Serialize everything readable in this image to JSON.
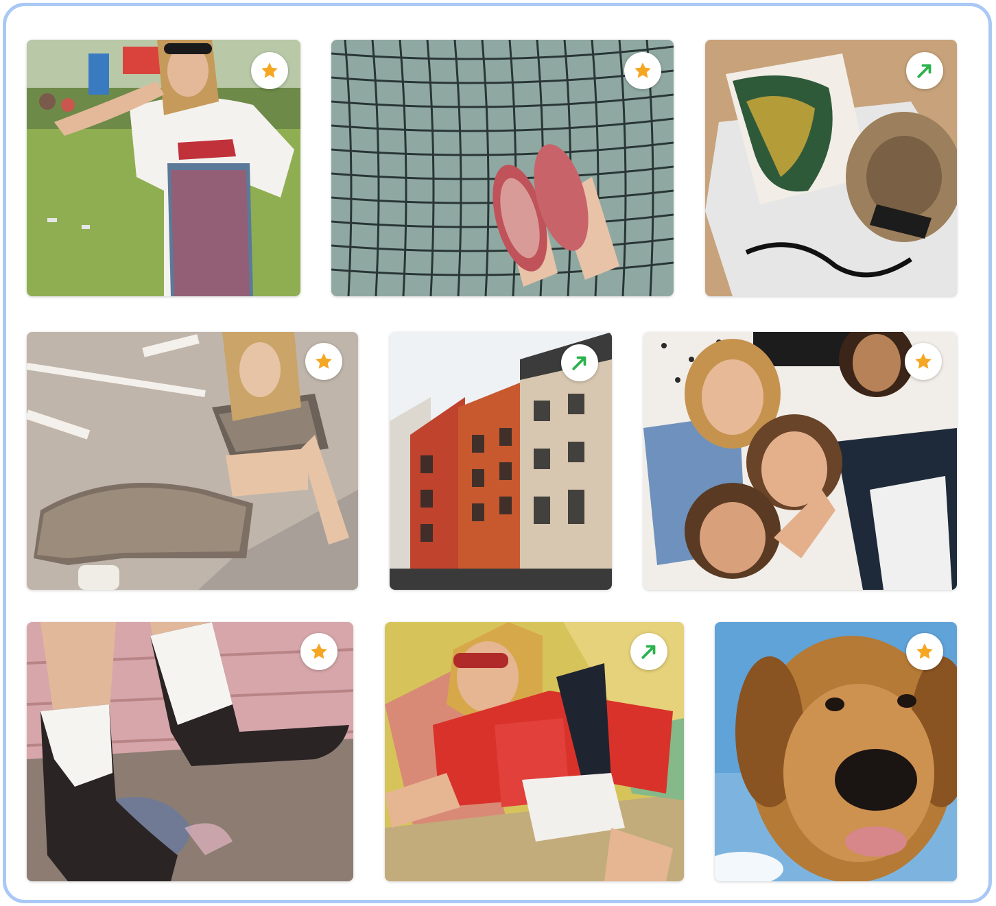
{
  "gallery": {
    "accent_frame_color": "#a9c8f5",
    "badge_colors": {
      "star": "#f5a623",
      "trending": "#2bb24c"
    },
    "tiles": [
      {
        "subject": "festival-outfit-photo",
        "badge": "star-icon"
      },
      {
        "subject": "tennis-net-sneakers-photo",
        "badge": "star-icon"
      },
      {
        "subject": "beach-towel-hat-photo",
        "badge": "trending-arrow-icon"
      },
      {
        "subject": "gingham-set-photo",
        "badge": "star-icon"
      },
      {
        "subject": "city-building-photo",
        "badge": "trending-arrow-icon"
      },
      {
        "subject": "friends-group-photo",
        "badge": "star-icon"
      },
      {
        "subject": "cowboy-boots-photo",
        "badge": "star-icon"
      },
      {
        "subject": "red-jacket-photo",
        "badge": "trending-arrow-icon"
      },
      {
        "subject": "golden-retriever-photo",
        "badge": "star-icon"
      }
    ]
  }
}
